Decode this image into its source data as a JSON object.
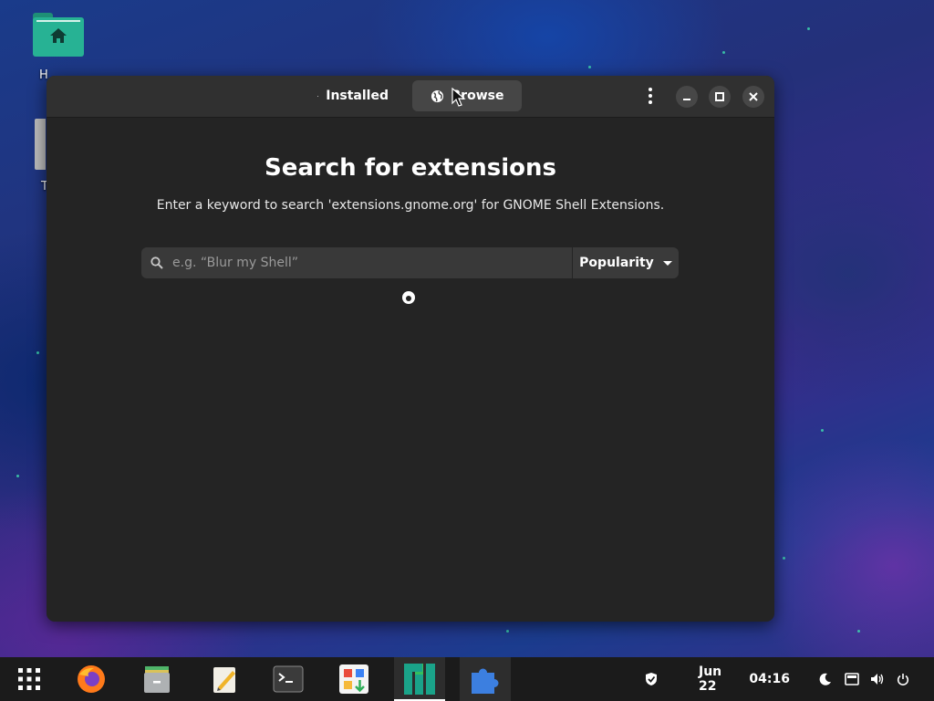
{
  "desktop": {
    "icons": [
      {
        "label": "H",
        "icon": "home-folder-icon"
      },
      {
        "label": "T",
        "icon": "trash-icon"
      }
    ]
  },
  "window": {
    "tabs": [
      {
        "label": "Installed",
        "icon": "puzzle-icon",
        "active": false
      },
      {
        "label": "Browse",
        "icon": "globe-icon",
        "active": true
      }
    ],
    "controls": [
      "menu-icon",
      "minimize-icon",
      "maximize-icon",
      "close-icon"
    ]
  },
  "main": {
    "title": "Search for extensions",
    "subtitle": "Enter a keyword to search 'extensions.gnome.org' for GNOME Shell Extensions.",
    "search_placeholder": "e.g. “Blur my Shell”",
    "sort_label": "Popularity"
  },
  "taskbar": {
    "apps": [
      {
        "name": "app-grid-icon"
      },
      {
        "name": "firefox-icon"
      },
      {
        "name": "files-icon"
      },
      {
        "name": "text-editor-icon"
      },
      {
        "name": "terminal-icon"
      },
      {
        "name": "software-icon"
      },
      {
        "name": "manjaro-icon"
      },
      {
        "name": "extension-manager-icon"
      }
    ],
    "date": "Jun 22",
    "time": "04:16"
  },
  "colors": {
    "window_bg": "#242424",
    "headerbar_bg": "#303030",
    "accent_green": "#27b294",
    "extension_blue": "#3c7fe0"
  }
}
